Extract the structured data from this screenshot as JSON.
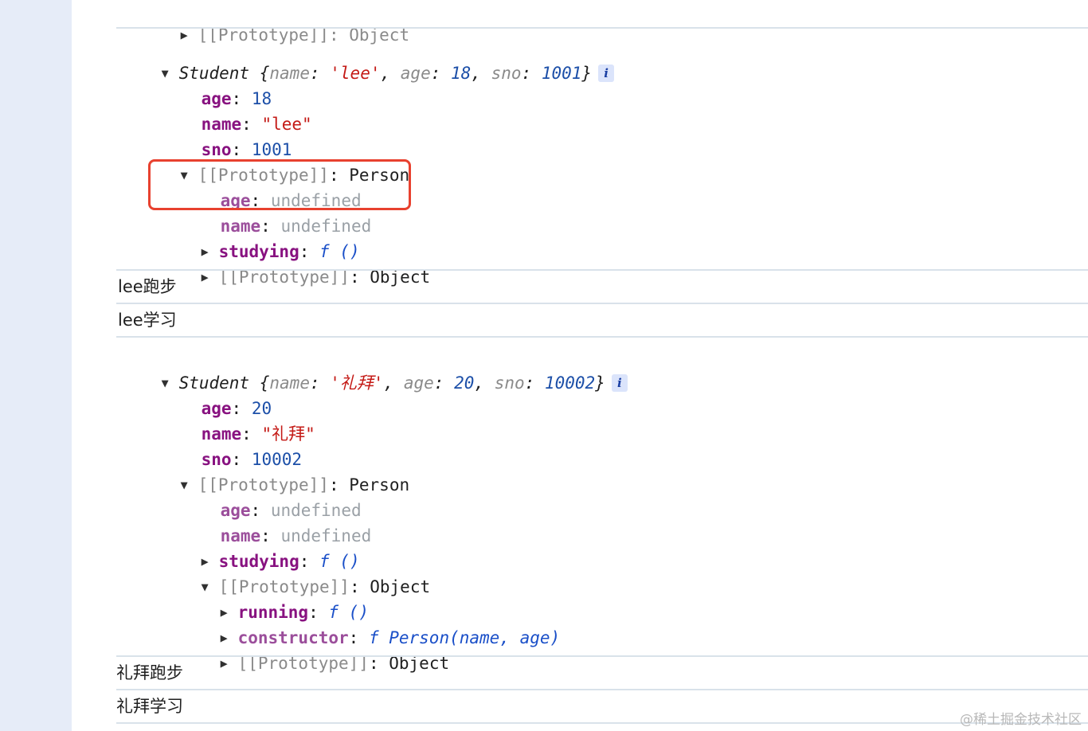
{
  "console": {
    "top_line": "[[Prototype]]: Object",
    "student1": {
      "header_class": "Student",
      "header_preview": [
        "name",
        "'lee'",
        "age",
        "18",
        "sno",
        "1001"
      ],
      "age_key": "age",
      "age_val": "18",
      "name_key": "name",
      "name_val": "\"lee\"",
      "sno_key": "sno",
      "sno_val": "1001",
      "proto_label": "[[Prototype]]",
      "proto_type": "Person",
      "p_age_key": "age",
      "p_age_val": "undefined",
      "p_name_key": "name",
      "p_name_val": "undefined",
      "studying_key": "studying",
      "studying_val": "f ()",
      "proto2_label": "[[Prototype]]",
      "proto2_type": "Object"
    },
    "log1": "lee跑步",
    "log2": "lee学习",
    "student2": {
      "header_class": "Student",
      "header_preview": [
        "name",
        "'礼拜'",
        "age",
        "20",
        "sno",
        "10002"
      ],
      "age_key": "age",
      "age_val": "20",
      "name_key": "name",
      "name_val": "\"礼拜\"",
      "sno_key": "sno",
      "sno_val": "10002",
      "proto_label": "[[Prototype]]",
      "proto_type": "Person",
      "p_age_key": "age",
      "p_age_val": "undefined",
      "p_name_key": "name",
      "p_name_val": "undefined",
      "studying_key": "studying",
      "studying_val": "f ()",
      "proto2_label": "[[Prototype]]",
      "proto2_type": "Object",
      "running_key": "running",
      "running_val": "f ()",
      "constructor_key": "constructor",
      "constructor_val": "f Person(name, age)",
      "proto3_label": "[[Prototype]]",
      "proto3_type": "Object"
    },
    "log3": "礼拜跑步",
    "log4": "礼拜学习"
  },
  "watermark": "@稀土掘金技术社区",
  "colors": {
    "highlight_border": "#e8412f",
    "sidebar": "#e6ecf8"
  }
}
